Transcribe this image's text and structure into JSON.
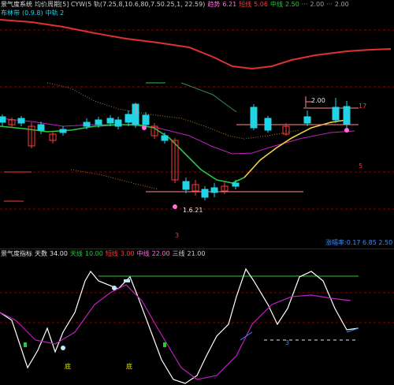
{
  "colors": {
    "up": "#22d3e6",
    "down": "#ff3a3a",
    "ma_slow": "#e03030",
    "ma_fast_green": "#27c93f",
    "ma_fast_yellow": "#f1d33a",
    "magenta": "#c020c0",
    "white": "#ffffff",
    "yellow": "#e6e600",
    "pink": "#ff6fd8",
    "grid_red": "#8a0000"
  },
  "main_header": {
    "line1": [
      {
        "text": "景气度系统",
        "color": "#e6e6e6"
      },
      {
        "text": "均价周期[5] CYW(5 轨(7.25,8,10.6,80,7.50.25,1, 22.59)",
        "color": "#cfcfcf"
      },
      {
        "text": "趋势",
        "color": "#ff6fd8"
      },
      {
        "text": "6.21",
        "color": "#ff6fd8"
      },
      {
        "text": "短线",
        "color": "#ff3a3a"
      },
      {
        "text": "5.06",
        "color": "#ff3a3a"
      },
      {
        "text": "中线",
        "color": "#27c93f"
      },
      {
        "text": "2.50",
        "color": "#27c93f"
      },
      {
        "text": "···",
        "color": "#a0a0a0"
      },
      {
        "text": "2.00",
        "color": "#a0a0a0"
      },
      {
        "text": "···",
        "color": "#a0a0a0"
      },
      {
        "text": "2.00",
        "color": "#a0a0a0"
      }
    ],
    "line2": [
      {
        "text": "布林带",
        "color": "#22d3e6"
      },
      {
        "text": "(0.9.8)",
        "color": "#22d3e6"
      },
      {
        "text": "中轨 2",
        "color": "#22d3e6"
      }
    ]
  },
  "main_labels": {
    "high_price": "2.00",
    "right_1": "17",
    "right_2": "5",
    "low_price": "1.6.21",
    "bottom_tag": "3",
    "bottom_right": "涨幅率:0.17 6.85 2.50"
  },
  "ind_header": [
    {
      "text": "景气度指标",
      "color": "#e6e6e6"
    },
    {
      "text": "天数",
      "color": "#e6e6e6"
    },
    {
      "text": "34.00",
      "color": "#e6e6e6"
    },
    {
      "text": "天线",
      "color": "#27c93f"
    },
    {
      "text": "10.00",
      "color": "#27c93f"
    },
    {
      "text": "短线",
      "color": "#ff3a3a"
    },
    {
      "text": "3.00",
      "color": "#ff3a3a"
    },
    {
      "text": "中线",
      "color": "#ff6fd8"
    },
    {
      "text": "22.00",
      "color": "#ff6fd8"
    },
    {
      "text": "三线",
      "color": "#cfcfcf"
    },
    {
      "text": "21.00",
      "color": "#cfcfcf"
    }
  ],
  "ind_labels": {
    "a": "底",
    "b": "底",
    "c": "3"
  }
}
